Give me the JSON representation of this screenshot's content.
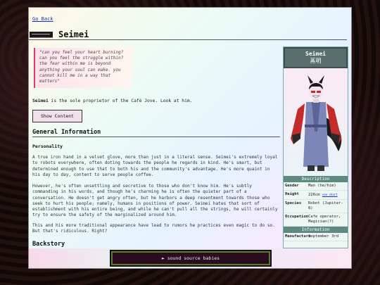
{
  "nav": {
    "back_label": "Go Back"
  },
  "page": {
    "title": "Seimei"
  },
  "quote": {
    "lines": [
      "\"can you feel your heart burning?",
      "can you feel the struggle within?",
      "the fear within me is beyond",
      "anything your soul can make. you",
      "cannot kill me in a way that",
      "matters\""
    ]
  },
  "intro": {
    "name": "Seimei",
    "rest": " is the sole proprietor of the Café Jove. Look at him."
  },
  "show_button": {
    "label": "Show Content"
  },
  "sections": {
    "general": "General Information",
    "personality": "Personality",
    "backstory": "Backstory"
  },
  "paragraphs": [
    "A true iron hand in a velvet glove, more than just in a literal sense. Seimei's extremely loyal to robots everywhere, often doting towards the people he regards in kind. He's smart, but determined enough to use that to both his and the community's advantage. He's more quaint in his day to day, content to serve people coffee.",
    "However, he's often unsettling and secretive to those who don't know him. He's subtly commanding in his words, and though he's charming he is often the quieter part of a conversation. He doesn't get angry often, but he harbors a deep resentment towards those who seek to hurt his people; namely, humans in positions of power. Seimei hates that sort of establishment with his entire being, and while he can't pull all the strings, he will certainly try to ensure the safety of the marginalized around him.",
    "This and his more traditional appearance have lead to rumors he practices even magic to do so. But that's ridiculous. Right?"
  ],
  "sidebar": {
    "name": "Seimei",
    "kanji": "蒸明",
    "section_description": "Description",
    "section_information": "Information",
    "rows": [
      {
        "key": "Gender",
        "value": "Man (he/him)"
      },
      {
        "key": "Height",
        "value": "226cm",
        "link": "see chart"
      },
      {
        "key": "Species",
        "value": "Robot (Jupiter-8)"
      },
      {
        "key": "Occupation",
        "value": "Cafe operator, Magician(?)"
      }
    ],
    "info_rows": [
      {
        "key": "Manufacture",
        "value": "September 3rd"
      }
    ]
  },
  "player": {
    "label": "► sound source babies"
  },
  "colors": {
    "accent": "#e03a6a",
    "sidebar_head": "#5a6e6e",
    "sidebar_section": "#5f8a80",
    "link": "#1a2ecc"
  }
}
